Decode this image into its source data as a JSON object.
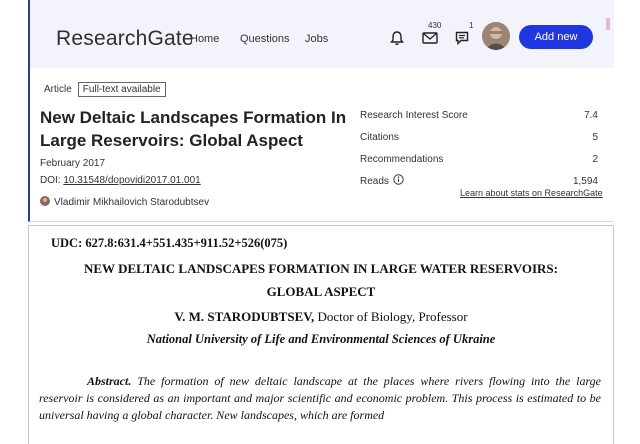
{
  "header": {
    "logo": "ResearchGate",
    "nav": [
      "Home",
      "Questions",
      "Jobs"
    ],
    "messages_count": "430",
    "notifications_count": "1",
    "add_new_label": "Add new",
    "accent_color": "#1f36e0"
  },
  "article": {
    "type_label": "Article",
    "fulltext_label": "Full-text available",
    "title": "New Deltaic Landscapes Formation In Large Reservoirs: Global Aspect",
    "date": "February 2017",
    "doi_prefix": "DOI: ",
    "doi": "10.31548/dopovidi2017.01.001",
    "author": "Vladimir Mikhailovich Starodubtsev"
  },
  "stats": {
    "rows": [
      {
        "label": "Research Interest Score",
        "value": "7.4"
      },
      {
        "label": "Citations",
        "value": "5"
      },
      {
        "label": "Recommendations",
        "value": "2"
      },
      {
        "label": "Reads",
        "value": "1,594"
      }
    ],
    "link": "Learn about stats on ResearchGate"
  },
  "document": {
    "udc": "UDC: 627.8:631.4+551.435+911.52+526(075)",
    "title_line1": "NEW DELTAIC LANDSCAPES FORMATION IN LARGE WATER RESERVOIRS:",
    "title_line2": "GLOBAL ASPECT",
    "author_name": "V. M. STARODUBTSEV,",
    "author_role": " Doctor of Biology, Professor",
    "institution": "National University of Life and Environmental Sciences of Ukraine",
    "abstract_label": "Abstract.",
    "abstract_text": " The formation of new deltaic landscape at the places where rivers flowing into the large reservoir is considered as an important and major scientific and economic problem. This process is estimated to be universal having a global character. New landscapes, which are formed"
  }
}
